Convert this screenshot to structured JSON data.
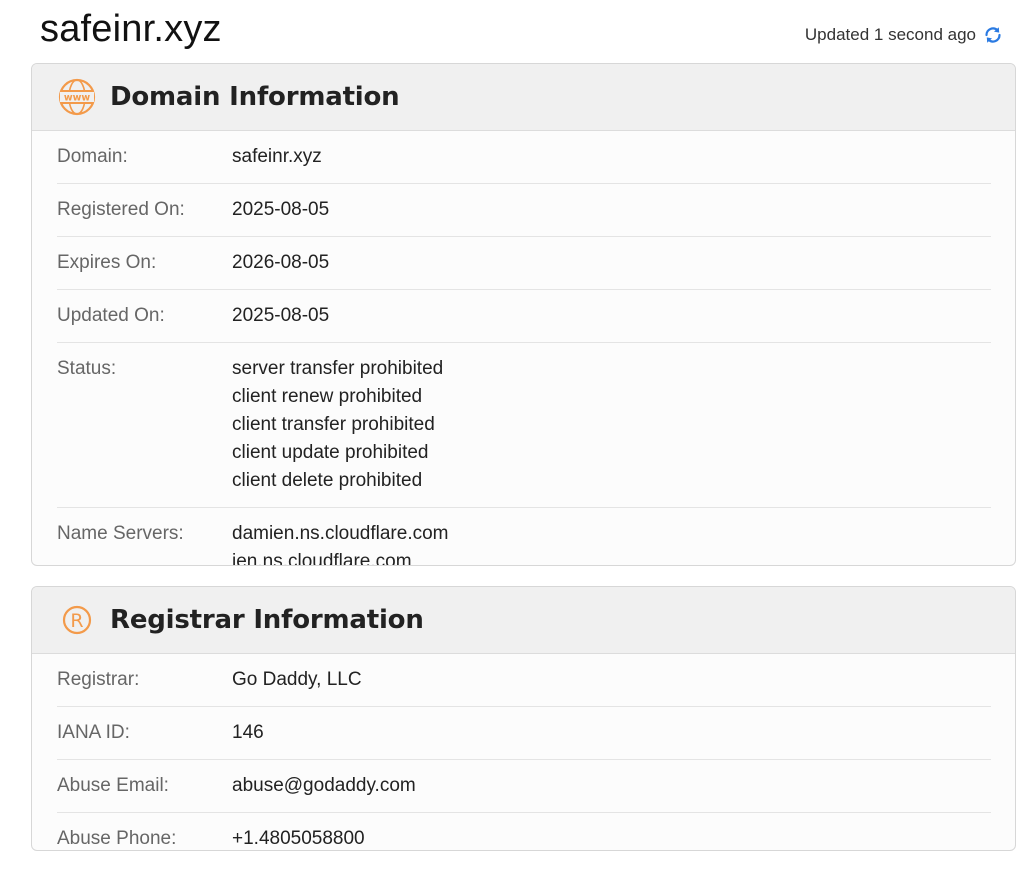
{
  "header": {
    "domain": "safeinr.xyz",
    "updated_text": "Updated 1 second ago",
    "refresh_icon": "refresh-icon",
    "accent": "#2a7ae2"
  },
  "domain_info": {
    "title": "Domain Information",
    "icon": "www-icon",
    "icon_color": "#f39a4a",
    "rows": [
      {
        "label": "Domain:",
        "values": [
          "safeinr.xyz"
        ]
      },
      {
        "label": "Registered On:",
        "values": [
          "2025-08-05"
        ]
      },
      {
        "label": "Expires On:",
        "values": [
          "2026-08-05"
        ]
      },
      {
        "label": "Updated On:",
        "values": [
          "2025-08-05"
        ]
      },
      {
        "label": "Status:",
        "values": [
          "server transfer prohibited",
          "client renew prohibited",
          "client transfer prohibited",
          "client update prohibited",
          "client delete prohibited"
        ]
      },
      {
        "label": "Name Servers:",
        "values": [
          "damien.ns.cloudflare.com",
          "jen.ns.cloudflare.com"
        ]
      }
    ]
  },
  "registrar_info": {
    "title": "Registrar Information",
    "icon": "registered-icon",
    "icon_color": "#f39a4a",
    "rows": [
      {
        "label": "Registrar:",
        "values": [
          "Go Daddy, LLC"
        ]
      },
      {
        "label": "IANA ID:",
        "values": [
          "146"
        ]
      },
      {
        "label": "Abuse Email:",
        "values": [
          "abuse@godaddy.com"
        ]
      },
      {
        "label": "Abuse Phone:",
        "values": [
          "+1.4805058800"
        ]
      }
    ]
  }
}
